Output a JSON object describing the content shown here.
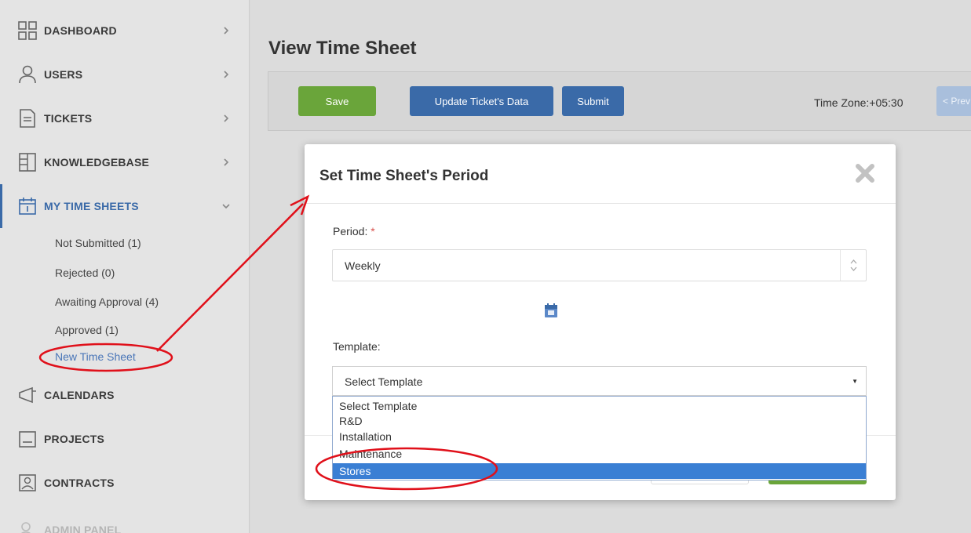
{
  "sidebar": {
    "items": [
      {
        "label": "DASHBOARD",
        "icon": "grid-icon"
      },
      {
        "label": "USERS",
        "icon": "user-icon"
      },
      {
        "label": "TICKETS",
        "icon": "document-icon"
      },
      {
        "label": "KNOWLEDGEBASE",
        "icon": "book-icon"
      },
      {
        "label": "MY TIME SHEETS",
        "icon": "calendar-icon"
      },
      {
        "label": "CALENDARS",
        "icon": "megaphone-icon"
      },
      {
        "label": "PROJECTS",
        "icon": "folder-icon"
      },
      {
        "label": "CONTRACTS",
        "icon": "contract-icon"
      },
      {
        "label": "ADMIN PANEL",
        "icon": "admin-icon"
      }
    ],
    "timesheet_sub": [
      {
        "label": "Not Submitted (1)"
      },
      {
        "label": "Rejected (0)"
      },
      {
        "label": "Awaiting Approval (4)"
      },
      {
        "label": "Approved (1)"
      },
      {
        "label": "New Time Sheet"
      }
    ]
  },
  "main": {
    "title": "View Time Sheet",
    "buttons": {
      "save": "Save",
      "update": "Update Ticket's Data",
      "submit": "Submit",
      "prev": "< Prev"
    },
    "time_zone": "Time Zone:+05:30"
  },
  "modal": {
    "title": "Set Time Sheet's Period",
    "period_label": "Period:",
    "required_mark": "*",
    "period_value": "Weekly",
    "template_label": "Template:",
    "template_value": "Select Template",
    "template_options": [
      {
        "label": "Select Template"
      },
      {
        "label": "R&D"
      },
      {
        "label": "Installation"
      },
      {
        "label": "Maintenance"
      },
      {
        "label": "Stores"
      }
    ],
    "selected_option": "Stores"
  },
  "colors": {
    "accent_blue": "#3a6aa8",
    "save_green": "#6aa53a",
    "selection_blue": "#3a7fd4",
    "annotation_red": "#e0101a"
  }
}
